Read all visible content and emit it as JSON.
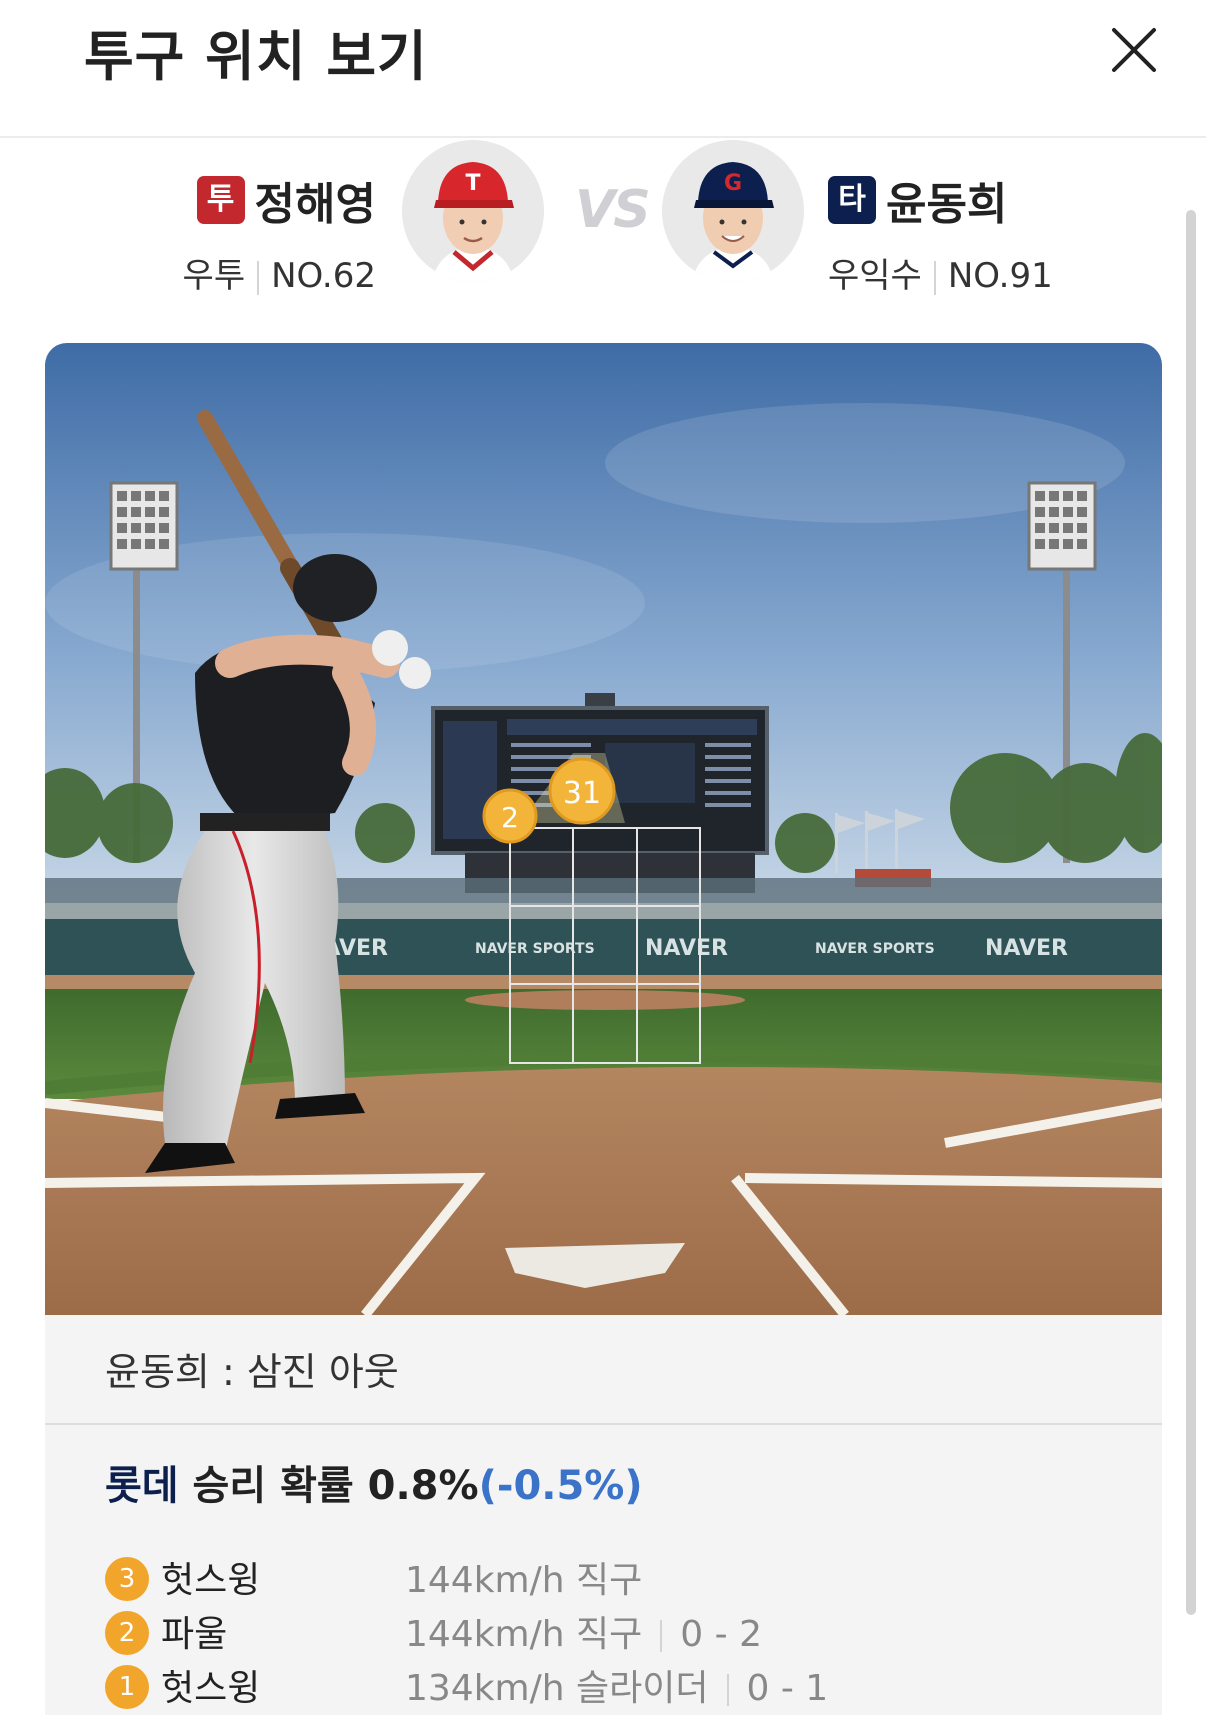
{
  "header": {
    "title": "투구 위치 보기"
  },
  "matchup": {
    "pitcher": {
      "badge": "투",
      "name": "정해영",
      "hand": "우투",
      "number": "NO.62"
    },
    "vs": "VS",
    "batter": {
      "badge": "타",
      "name": "윤동희",
      "position": "우익수",
      "number": "NO.91"
    }
  },
  "field": {
    "pitch_markers": [
      "2",
      "31"
    ],
    "signage": [
      "NAVER",
      "NAVER SPORTS",
      "NAVER",
      "NAVER SPORTS",
      "NAVER"
    ]
  },
  "result": {
    "summary": "윤동희 : 삼진 아웃",
    "win_probability": {
      "team": "롯데",
      "label": "승리 확률",
      "value": "0.8%",
      "change": "(-0.5%)"
    },
    "pitches": [
      {
        "num": "3",
        "result": "헛스윙",
        "speed": "144km/h",
        "type": "직구",
        "count": ""
      },
      {
        "num": "2",
        "result": "파울",
        "speed": "144km/h",
        "type": "직구",
        "count": "0 - 2"
      },
      {
        "num": "1",
        "result": "헛스윙",
        "speed": "134km/h",
        "type": "슬라이더",
        "count": "0 - 1"
      }
    ]
  },
  "colors": {
    "pitcher_badge": "#c2282d",
    "batter_badge": "#0d1f4f",
    "pitch_marker": "#f2a52b",
    "change_blue": "#3a73c8"
  }
}
